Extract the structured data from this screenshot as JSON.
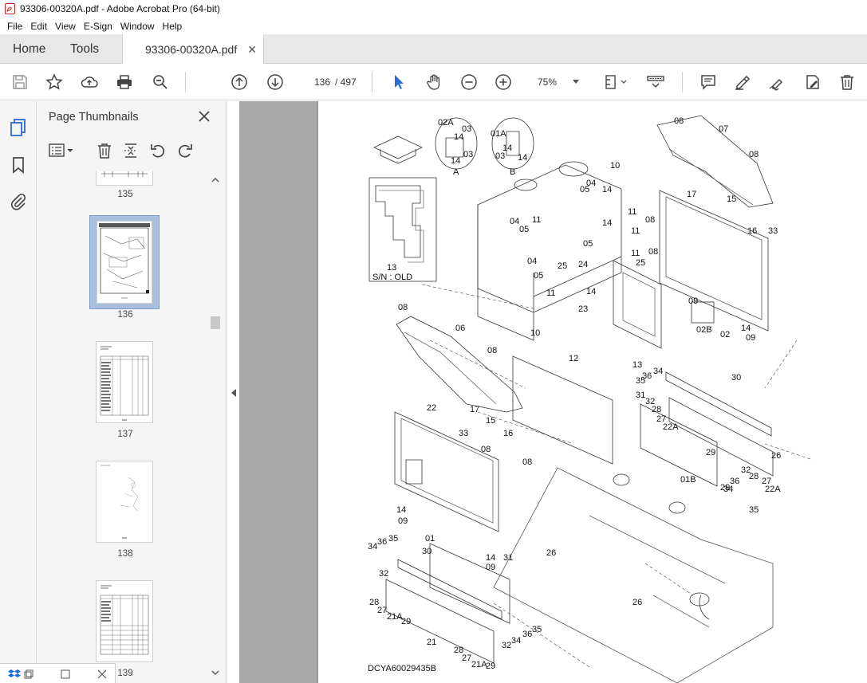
{
  "window": {
    "title": "93306-00320A.pdf - Adobe Acrobat Pro (64-bit)"
  },
  "menu": [
    "File",
    "Edit",
    "View",
    "E-Sign",
    "Window",
    "Help"
  ],
  "tabs": {
    "home": "Home",
    "tools": "Tools",
    "document": "93306-00320A.pdf"
  },
  "toolbar": {
    "current_page": "136",
    "total_pages": "/ 497",
    "zoom": "75%"
  },
  "panel": {
    "title": "Page Thumbnails",
    "thumbnails": [
      {
        "label": "135"
      },
      {
        "label": "136",
        "selected": true
      },
      {
        "label": "137"
      },
      {
        "label": "138"
      },
      {
        "label": "139"
      }
    ]
  },
  "drawing": {
    "doc_code": "DCYA60029435B",
    "inset_a": {
      "callout": "A",
      "labels": [
        "02A",
        "03",
        "14",
        "14",
        "03"
      ]
    },
    "inset_b": {
      "callout": "B",
      "labels": [
        "01A",
        "14",
        "03",
        "14"
      ]
    },
    "inset_old": {
      "part": "13",
      "note": "S/N : OLD"
    },
    "callouts": [
      "08",
      "07",
      "08",
      "10",
      "05",
      "04",
      "14",
      "11",
      "17",
      "15",
      "16",
      "33",
      "08",
      "14",
      "11",
      "08",
      "05",
      "11",
      "25",
      "24",
      "25",
      "23",
      "10",
      "04",
      "05",
      "11",
      "04",
      "05",
      "11",
      "14",
      "09",
      "02B",
      "02",
      "14",
      "09",
      "08",
      "06",
      "08",
      "12",
      "13",
      "34",
      "36",
      "35",
      "30",
      "31",
      "32",
      "28",
      "27",
      "22A",
      "29",
      "22",
      "17",
      "15",
      "16",
      "33",
      "08",
      "08",
      "01B",
      "26",
      "32",
      "28",
      "27",
      "22A",
      "29",
      "36",
      "34",
      "35",
      "26",
      "14",
      "09",
      "01",
      "34",
      "36",
      "35",
      "32",
      "30",
      "31",
      "28",
      "27",
      "21A",
      "29",
      "14",
      "09",
      "26",
      "21",
      "32",
      "34",
      "36",
      "35",
      "28",
      "27",
      "21A",
      "29",
      "26"
    ]
  },
  "colors": {
    "accent": "#2a6bd6",
    "doc_bg": "#a9a9a9",
    "pdf_red": "#d32020"
  }
}
